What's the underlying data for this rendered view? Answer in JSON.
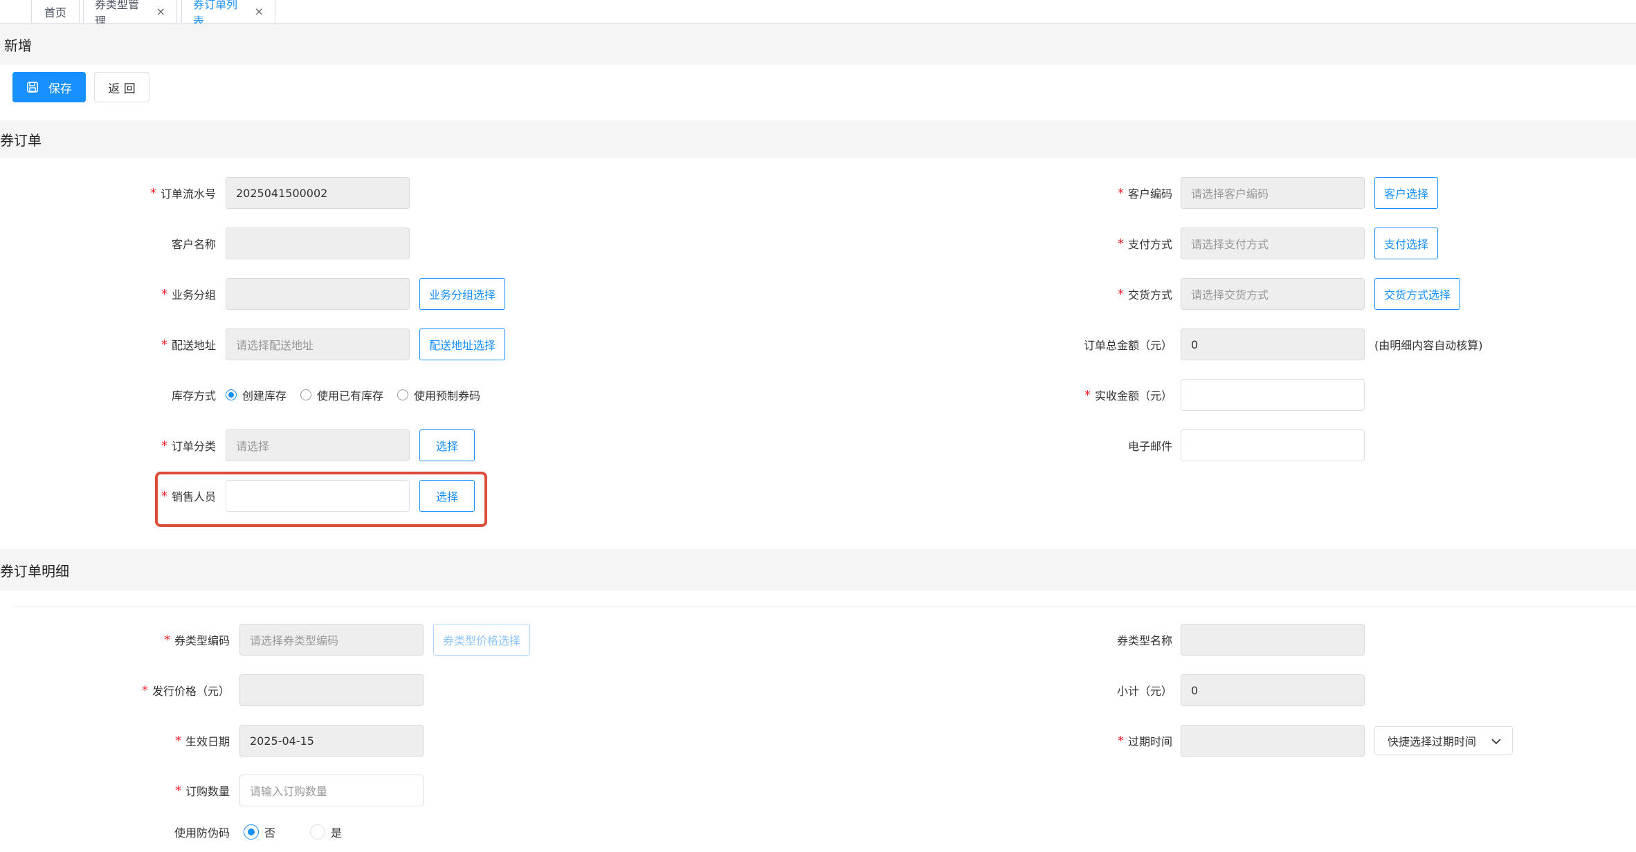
{
  "tabs": [
    {
      "label": "首页",
      "closable": false
    },
    {
      "label": "券类型管理",
      "closable": true
    },
    {
      "label": "券订单列表",
      "closable": true,
      "active": true
    }
  ],
  "page_title": "新增",
  "toolbar": {
    "save_label": "保存",
    "back_label": "返 回"
  },
  "order_section": {
    "title": "券订单",
    "serial_label": "订单流水号",
    "serial_value": "2025041500002",
    "customer_name_label": "客户名称",
    "group_label": "业务分组",
    "group_button": "业务分组选择",
    "address_label": "配送地址",
    "address_placeholder": "请选择配送地址",
    "address_button": "配送地址选择",
    "stock_label": "库存方式",
    "stock_options": [
      "创建库存",
      "使用已有库存",
      "使用预制券码"
    ],
    "category_label": "订单分类",
    "category_placeholder": "请选择",
    "category_button": "选择",
    "sales_label": "销售人员",
    "sales_button": "选择",
    "customer_code_label": "客户编码",
    "customer_code_placeholder": "请选择客户编码",
    "customer_code_button": "客户选择",
    "payment_label": "支付方式",
    "payment_placeholder": "请选择支付方式",
    "payment_button": "支付选择",
    "delivery_label": "交货方式",
    "delivery_placeholder": "请选择交货方式",
    "delivery_button": "交货方式选择",
    "total_label": "订单总金额（元）",
    "total_value": "0",
    "total_hint": "(由明细内容自动核算)",
    "received_label": "实收金额（元）",
    "email_label": "电子邮件"
  },
  "detail_section": {
    "title": "券订单明细",
    "type_code_label": "券类型编码",
    "type_code_placeholder": "请选择券类型编码",
    "type_code_button": "券类型价格选择",
    "price_label": "发行价格（元）",
    "effective_label": "生效日期",
    "effective_value": "2025-04-15",
    "qty_label": "订购数量",
    "qty_placeholder": "请输入订购数量",
    "anti_fake_label": "使用防伪码",
    "anti_fake_options": [
      "否",
      "是"
    ],
    "type_name_label": "券类型名称",
    "subtotal_label": "小计（元）",
    "subtotal_value": "0",
    "expire_label": "过期时间",
    "expire_select": "快捷选择过期时间"
  }
}
